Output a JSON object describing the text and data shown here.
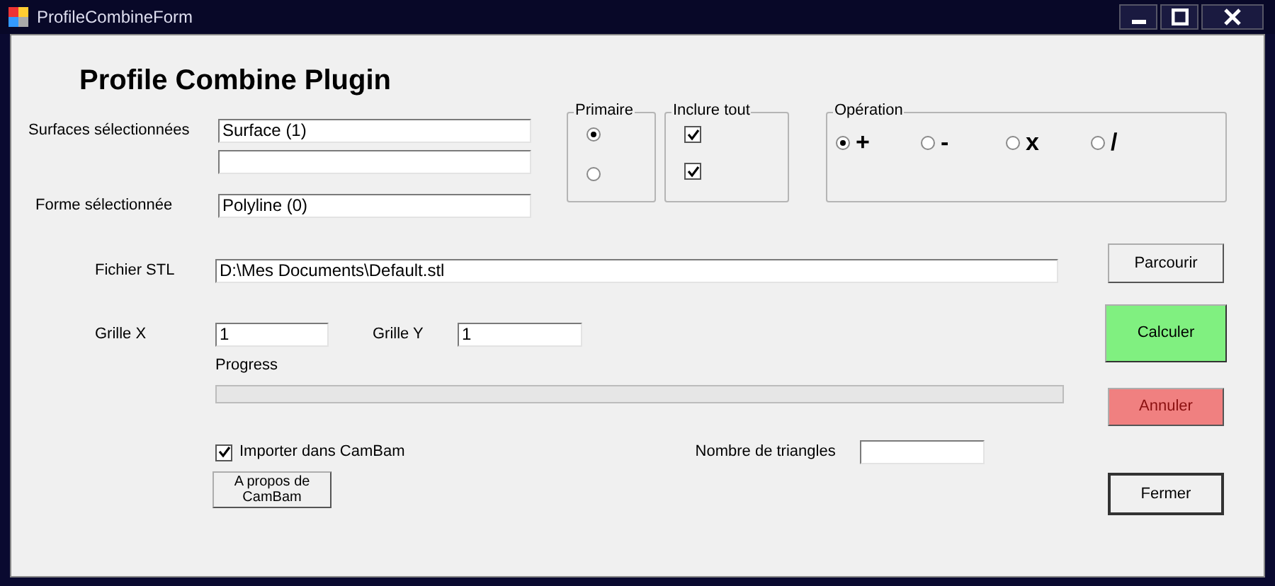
{
  "window": {
    "title": "ProfileCombineForm",
    "controls": [
      {
        "kind": "minimize"
      },
      {
        "kind": "maximize"
      },
      {
        "kind": "close"
      }
    ]
  },
  "heading": "Profile Combine Plugin",
  "fields": [
    {
      "label": "Surfaces sélectionnées",
      "boxes": [
        {
          "kind": "textbox",
          "value": "Surface (1)"
        },
        {
          "kind": "textbox"
        }
      ]
    },
    {
      "label": "Forme sélectionnée",
      "boxes": [
        {
          "kind": "textbox",
          "value": "Polyline (0)"
        }
      ]
    }
  ],
  "primaire": {
    "title": "Primaire",
    "options": [
      {
        "selected": true
      },
      {
        "selected": false
      }
    ]
  },
  "inclure_tout": {
    "title": "Inclure tout",
    "options": [
      {
        "checked": true
      },
      {
        "checked": true
      }
    ]
  },
  "operation": {
    "title": "Opération",
    "options": [
      {
        "label": "+",
        "selected": true
      },
      {
        "label": "-",
        "selected": false
      },
      {
        "label": "x",
        "selected": false
      },
      {
        "label": "/",
        "selected": false
      }
    ]
  },
  "stl": {
    "label": "Fichier STL",
    "value": "D:\\Mes Documents\\Default.stl"
  },
  "grid_x": {
    "label": "Grille X",
    "value": "1"
  },
  "grid_y": {
    "label": "Grille Y",
    "value": "1"
  },
  "progress": {
    "label": "Progress"
  },
  "import": {
    "label": "Importer dans CamBam",
    "checked": true
  },
  "triangles": {
    "label": "Nombre de triangles"
  },
  "about_button": "A propos de CamBam",
  "buttons": [
    {
      "label": "Parcourir",
      "kind": "plain",
      "disabled": false
    },
    {
      "label": "Calculer",
      "kind": "go",
      "disabled": false
    },
    {
      "label": "Annuler",
      "kind": "stop",
      "disabled": true
    },
    {
      "label": "Fermer",
      "kind": "default",
      "disabled": false
    }
  ]
}
